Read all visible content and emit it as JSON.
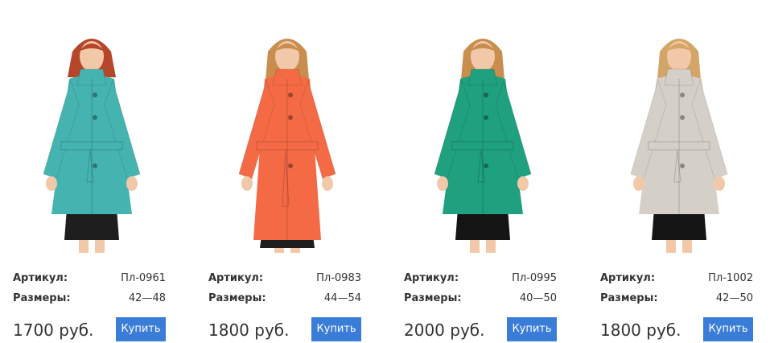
{
  "labels": {
    "article": "Артикул:",
    "sizes": "Размеры:",
    "buy": "Купить"
  },
  "products": [
    {
      "article": "Пл-0961",
      "sizes": "42—48",
      "price": "1700 руб.",
      "coat_color": "#45b3b0",
      "hair_color": "#b5462a",
      "skirt_color": "#1e1e1e",
      "illustration_icon": "turquoise-jacket-model"
    },
    {
      "article": "Пл-0983",
      "sizes": "44—54",
      "price": "1800 руб.",
      "coat_color": "#f46a45",
      "hair_color": "#c98d4e",
      "skirt_color": "#1e1e1e",
      "illustration_icon": "coral-coat-model"
    },
    {
      "article": "Пл-0995",
      "sizes": "40—50",
      "price": "2000 руб.",
      "coat_color": "#1fa07e",
      "hair_color": "#c98d4e",
      "skirt_color": "#141414",
      "illustration_icon": "green-jacket-model"
    },
    {
      "article": "Пл-1002",
      "sizes": "42—50",
      "price": "1800 руб.",
      "coat_color": "#d4d0c8",
      "hair_color": "#d3a566",
      "skirt_color": "#141414",
      "illustration_icon": "beige-jacket-model"
    }
  ],
  "colors": {
    "button": "#3a7dd8",
    "text": "#333333"
  }
}
